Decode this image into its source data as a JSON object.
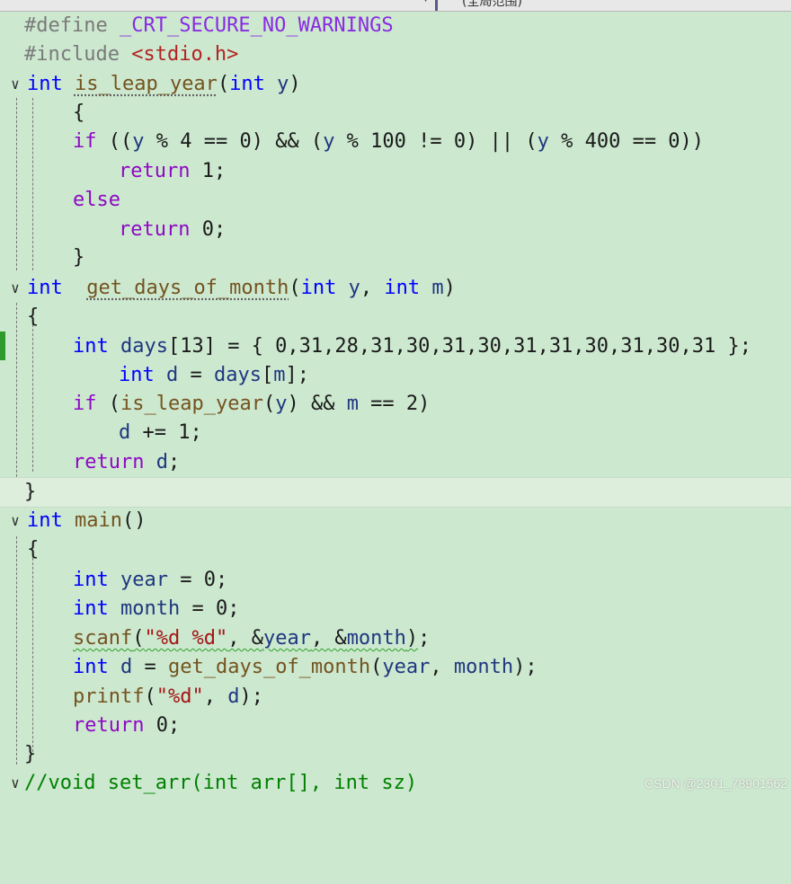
{
  "toolbar": {
    "scope_label": "(全局范围)",
    "dropdown_arrow": "chevron-down-icon"
  },
  "fold_glyph": "∨",
  "code": {
    "l1": {
      "t1": "#define ",
      "t2": "_CRT_SECURE_NO_WARNINGS"
    },
    "l2": {
      "t1": "#include ",
      "t2": "<stdio.h>"
    },
    "l3": {
      "t1": "int ",
      "t2": "is_leap_year",
      "t3": "(",
      "t4": "int ",
      "t5": "y",
      "t6": ")"
    },
    "l4": {
      "t1": "{"
    },
    "l5": {
      "t1": "if",
      "t2": " ((",
      "t3": "y",
      "t4": " % 4 == 0) && (",
      "t5": "y",
      "t6": " % 100 != 0) || (",
      "t7": "y",
      "t8": " % 400 == 0))"
    },
    "l6": {
      "t1": "return",
      "t2": " 1;"
    },
    "l7": {
      "t1": "else"
    },
    "l8": {
      "t1": "return",
      "t2": " 0;"
    },
    "l9": {
      "t1": "}"
    },
    "l10": {
      "t1": "int ",
      "t2": "get_days_of_month",
      "t3": "(",
      "t4": "int ",
      "t5": "y",
      "t6": ", ",
      "t7": "int ",
      "t8": "m",
      "t9": ")"
    },
    "l11": {
      "t1": "{"
    },
    "l12": {
      "t1": "int ",
      "t2": "days",
      "t3": "[13] = { 0,31,28,31,30,31,30,31,31,30,31,30,31 };"
    },
    "l13": {
      "t1": "int ",
      "t2": "d",
      "t3": " = ",
      "t4": "days",
      "t5": "[",
      "t6": "m",
      "t7": "];"
    },
    "l14": {
      "t1": "if",
      "t2": " (",
      "t3": "is_leap_year",
      "t4": "(",
      "t5": "y",
      "t6": ") && ",
      "t7": "m",
      "t8": " == 2)"
    },
    "l15": {
      "t1": "d",
      "t2": " += 1;"
    },
    "l16": {
      "t1": "return ",
      "t2": "d",
      "t3": ";"
    },
    "l17": {
      "t1": "}"
    },
    "l18": {
      "t1": "int ",
      "t2": "main",
      "t3": "()"
    },
    "l19": {
      "t1": "{"
    },
    "l20": {
      "t1": "int ",
      "t2": "year",
      "t3": " = 0;"
    },
    "l21": {
      "t1": "int ",
      "t2": "month",
      "t3": " = 0;"
    },
    "l22": {
      "t1": "scanf",
      "t2": "(",
      "t3": "\"%d %d\"",
      "t4": ", &",
      "t5": "year",
      "t6": ", &",
      "t7": "month",
      "t8": ")",
      "t9": ";"
    },
    "l23": {
      "t1": "int ",
      "t2": "d",
      "t3": " = ",
      "t4": "get_days_of_month",
      "t5": "(",
      "t6": "year",
      "t7": ", ",
      "t8": "month",
      "t9": ");"
    },
    "l24": {
      "t1": "printf",
      "t2": "(",
      "t3": "\"%d\"",
      "t4": ", ",
      "t5": "d",
      "t6": ");"
    },
    "l25": {
      "t1": "return",
      "t2": " 0;"
    },
    "l26": {
      "t1": "}"
    },
    "l27": {
      "t1": "//void set_arr(int arr[], int sz)"
    }
  },
  "watermark": "CSDN @2301_78901562",
  "colors": {
    "background": "#cce8cf",
    "keyword": "#0000ff",
    "function": "#74531f",
    "variable": "#1f377f",
    "string": "#a31515",
    "control": "#8f08c4",
    "comment": "#008000",
    "change_bar": "#2e9a2e"
  }
}
